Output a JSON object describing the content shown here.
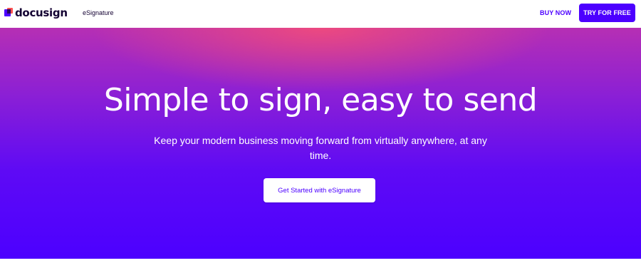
{
  "header": {
    "logo_text": "docusign",
    "product_label": "eSignature",
    "buy_now_label": "BUY NOW",
    "try_free_label": "TRY FOR FREE"
  },
  "hero": {
    "title": "Simple to sign, easy to send",
    "subtitle": "Keep your modern business moving forward from virtually anywhere, at any time.",
    "cta_label": "Get Started with eSignature"
  },
  "colors": {
    "brand_purple": "#4c00ff",
    "brand_dark": "#130032",
    "accent_coral": "#ff5252",
    "background": "#ffffff"
  },
  "icons": {
    "logo": "docusign-logo-icon"
  }
}
